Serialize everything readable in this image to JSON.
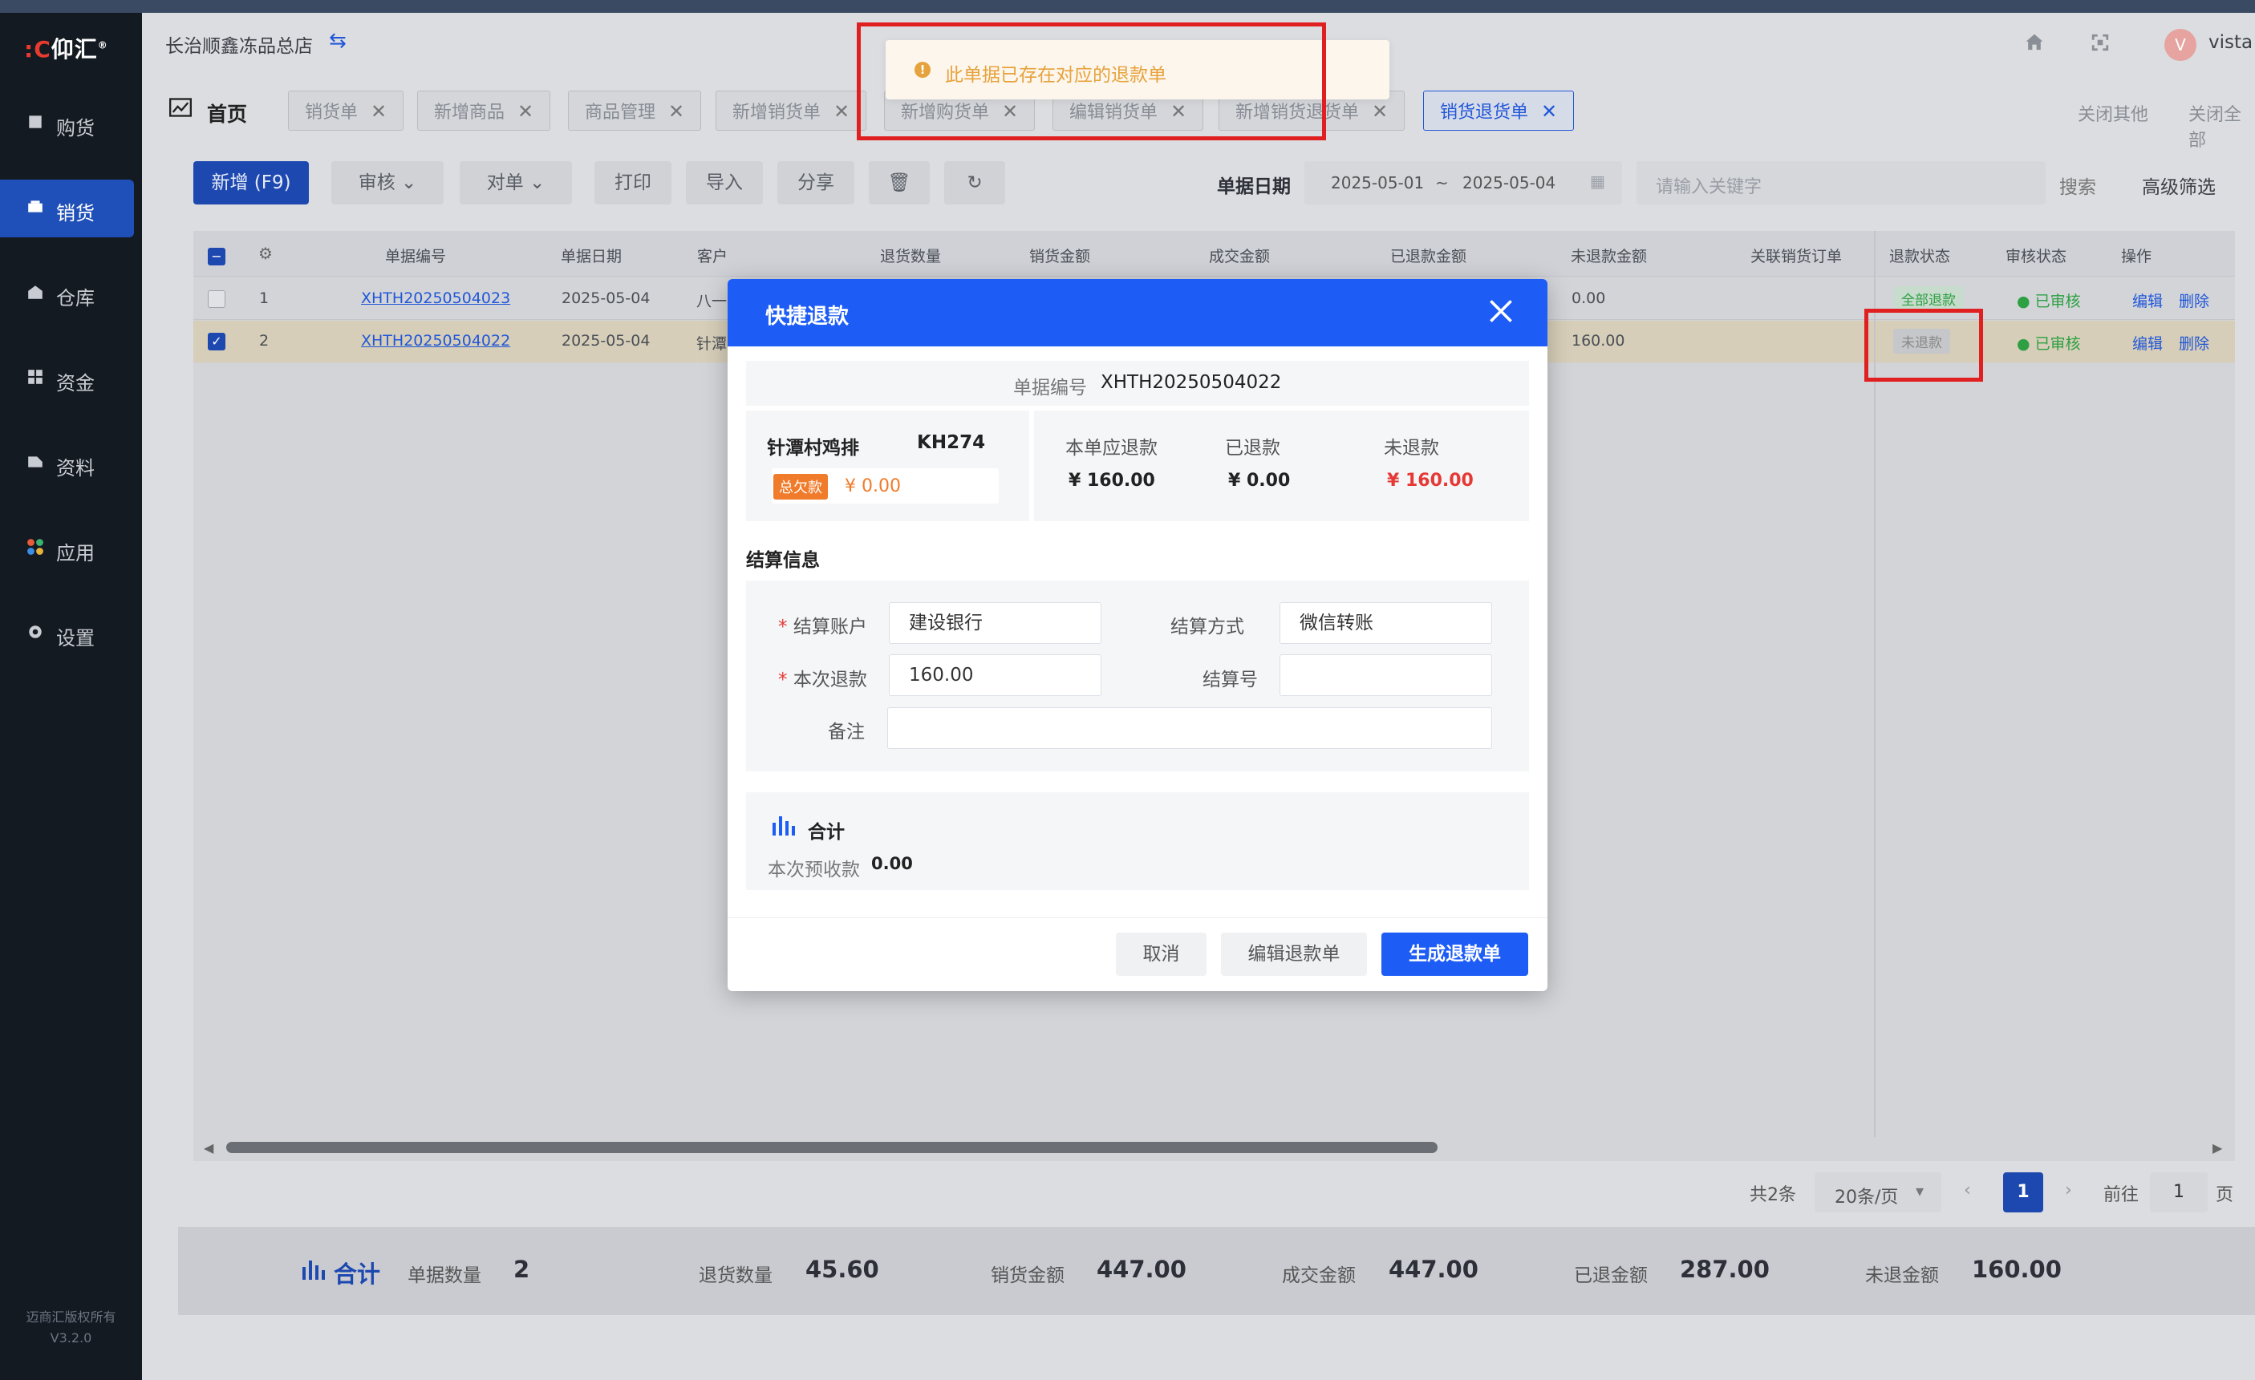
{
  "app": {
    "logo": "仰汇",
    "store_name": "长治顺鑫冻品总店",
    "username": "vista",
    "avatar_letter": "V",
    "copyright": "迈商汇版权所有",
    "version": "V3.2.0"
  },
  "sidebar": {
    "items": [
      {
        "label": "购货",
        "icon": "purchase-icon"
      },
      {
        "label": "销货",
        "icon": "sales-icon",
        "active": true
      },
      {
        "label": "仓库",
        "icon": "warehouse-icon"
      },
      {
        "label": "资金",
        "icon": "funds-icon"
      },
      {
        "label": "资料",
        "icon": "data-icon"
      },
      {
        "label": "应用",
        "icon": "apps-icon"
      },
      {
        "label": "设置",
        "icon": "settings-icon"
      }
    ]
  },
  "tabs": {
    "home": "首页",
    "items": [
      "销货单",
      "新增商品",
      "商品管理",
      "新增销货单",
      "新增购货单",
      "编辑销货单",
      "新增销货退货单",
      "销货退货单"
    ],
    "close_others": "关闭其他",
    "close_all": "关闭全部"
  },
  "toolbar": {
    "add": "新增 (F9)",
    "audit": "审核",
    "reconcile": "对单",
    "print": "打印",
    "import": "导入",
    "share": "分享",
    "date_label": "单据日期",
    "date_from": "2025-05-01",
    "date_sep": "~",
    "date_to": "2025-05-04",
    "search_placeholder": "请输入关键字",
    "search": "搜索",
    "advanced": "高级筛选"
  },
  "table": {
    "headers": [
      "单据编号",
      "单据日期",
      "客户",
      "退货数量",
      "销货金额",
      "成交金额",
      "已退款金额",
      "未退款金额",
      "关联销货订单",
      "退款状态",
      "审核状态",
      "操作"
    ],
    "rows": [
      {
        "idx": "1",
        "no": "XHTH20250504023",
        "date": "2025-05-04",
        "customer": "八一",
        "unrefunded": "0.00",
        "refund_status": "全部退款",
        "audit_status": "已审核",
        "edit": "编辑",
        "delete": "删除"
      },
      {
        "idx": "2",
        "no": "XHTH20250504022",
        "date": "2025-05-04",
        "customer": "针潭",
        "unrefunded": "160.00",
        "refund_status": "未退款",
        "audit_status": "已审核",
        "edit": "编辑",
        "delete": "删除"
      }
    ]
  },
  "pagination": {
    "total": "共2条",
    "page_size": "20条/页",
    "current": "1",
    "goto": "前往",
    "goto_value": "1",
    "page_unit": "页"
  },
  "summary": {
    "title": "合计",
    "count_label": "单据数量",
    "count": "2",
    "qty_label": "退货数量",
    "qty": "45.60",
    "sales_label": "销货金额",
    "sales": "447.00",
    "deal_label": "成交金额",
    "deal": "447.00",
    "refunded_label": "已退金额",
    "refunded": "287.00",
    "unrefunded_label": "未退金额",
    "unrefunded": "160.00"
  },
  "modal": {
    "title": "快捷退款",
    "doc_no_label": "单据编号",
    "doc_no": "XHTH20250504022",
    "customer": "针潭村鸡排",
    "customer_code": "KH274",
    "debt_badge": "总欠款",
    "debt": "¥ 0.00",
    "due_label": "本单应退款",
    "due": "¥ 160.00",
    "refunded_label": "已退款",
    "refunded": "¥ 0.00",
    "unrefunded_label": "未退款",
    "unrefunded": "¥ 160.00",
    "section_settle": "结算信息",
    "account_label": "结算账户",
    "account": "建设银行",
    "method_label": "结算方式",
    "method": "微信转账",
    "amount_label": "本次退款",
    "amount": "160.00",
    "settle_no_label": "结算号",
    "settle_no": "",
    "remark_label": "备注",
    "remark": "",
    "total_title": "合计",
    "prepay_label": "本次预收款",
    "prepay": "0.00",
    "cancel": "取消",
    "edit": "编辑退款单",
    "generate": "生成退款单"
  },
  "toast": {
    "message": "此单据已存在对应的退款单",
    "color": "#e6a23c"
  },
  "colors": {
    "primary": "#1d5cf5",
    "danger": "#e53935",
    "success": "#2ea043",
    "warning": "#e6a23c"
  }
}
